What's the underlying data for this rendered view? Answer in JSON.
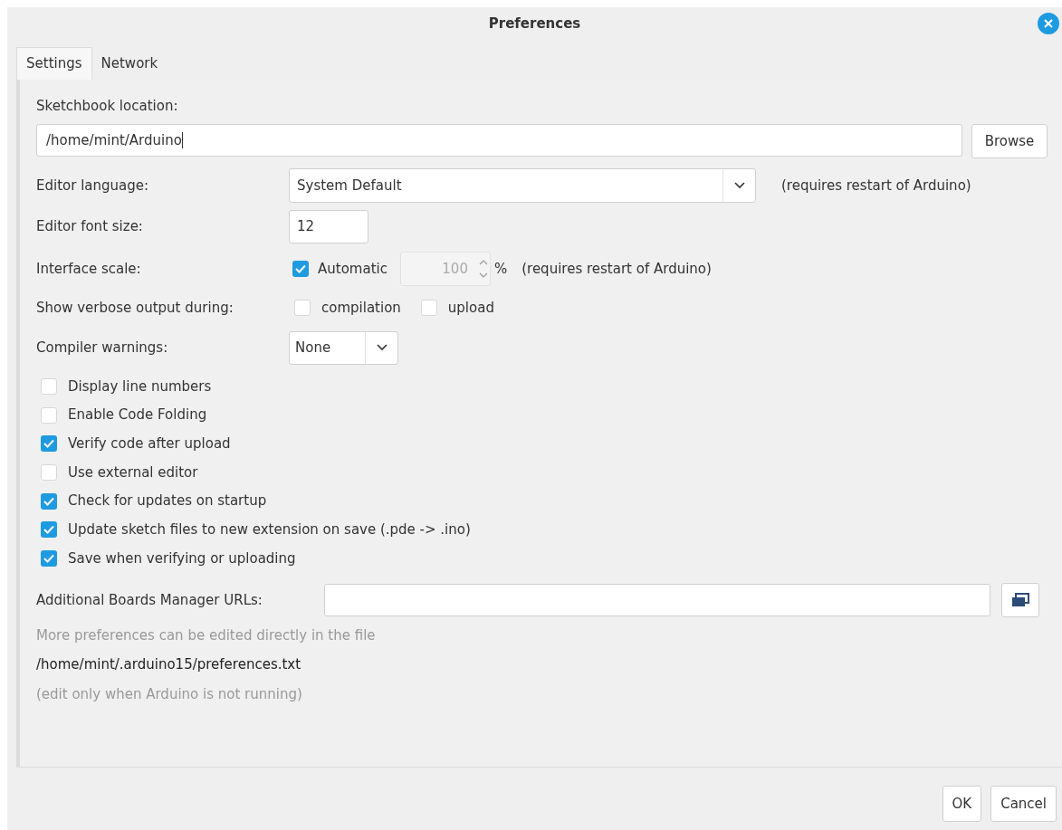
{
  "window": {
    "title": "Preferences"
  },
  "tabs": [
    {
      "label": "Settings",
      "selected": true
    },
    {
      "label": "Network",
      "selected": false
    }
  ],
  "sketchbook": {
    "label": "Sketchbook location:",
    "value": "/home/mint/Arduino",
    "button": "Browse"
  },
  "editor_language": {
    "label": "Editor language:",
    "value": "System Default",
    "note": "(requires restart of Arduino)"
  },
  "font_size": {
    "label": "Editor font size:",
    "value": "12"
  },
  "interface_scale": {
    "label": "Interface scale:",
    "automatic": {
      "label": "Automatic",
      "checked": true
    },
    "value": "100",
    "disabled": true,
    "unit": "%",
    "note": "(requires restart of Arduino)"
  },
  "verbose": {
    "label": "Show verbose output during:",
    "options": [
      {
        "label": "compilation",
        "checked": false
      },
      {
        "label": "upload",
        "checked": false
      }
    ]
  },
  "compiler_warnings": {
    "label": "Compiler warnings:",
    "value": "None"
  },
  "options": [
    {
      "label": "Display line numbers",
      "checked": false
    },
    {
      "label": "Enable Code Folding",
      "checked": false
    },
    {
      "label": "Verify code after upload",
      "checked": true
    },
    {
      "label": "Use external editor",
      "checked": false
    },
    {
      "label": "Check for updates on startup",
      "checked": true
    },
    {
      "label": "Update sketch files to new extension on save (.pde -> .ino)",
      "checked": true
    },
    {
      "label": "Save when verifying or uploading",
      "checked": true
    }
  ],
  "boards_manager": {
    "label": "Additional Boards Manager URLs:"
  },
  "info": {
    "hint": "More preferences can be edited directly in the file",
    "path": "/home/mint/.arduino15/preferences.txt",
    "note": "(edit only when Arduino is not running)"
  },
  "buttons": [
    "OK",
    "Cancel"
  ]
}
